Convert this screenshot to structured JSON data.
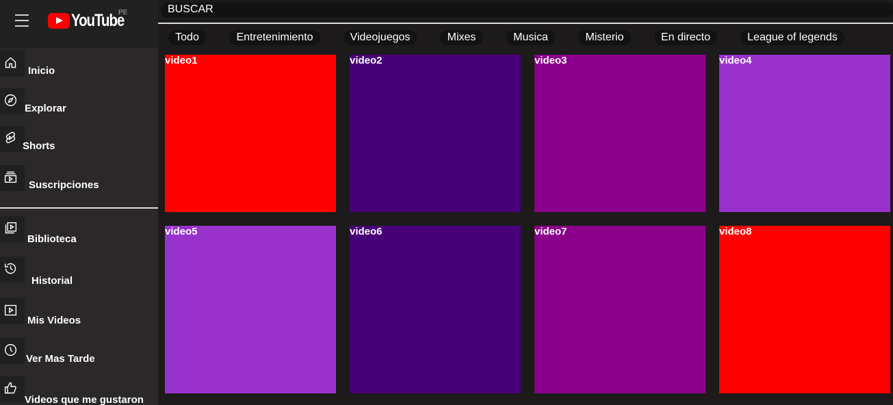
{
  "header": {
    "brand": "YouTube",
    "country": "PE",
    "search_placeholder": "BUSCAR"
  },
  "sidebar": {
    "main_items": [
      {
        "label": "Inicio",
        "icon": "home-icon"
      },
      {
        "label": "Explorar",
        "icon": "compass-icon"
      },
      {
        "label": "Shorts",
        "icon": "shorts-icon"
      },
      {
        "label": "Suscripciones",
        "icon": "subscriptions-icon"
      }
    ],
    "library_items": [
      {
        "label": "Biblioteca",
        "icon": "library-icon"
      },
      {
        "label": "Historial",
        "icon": "history-icon"
      },
      {
        "label": "Mis Videos",
        "icon": "my-videos-icon"
      },
      {
        "label": "Ver Mas Tarde",
        "icon": "clock-icon"
      },
      {
        "label": "Videos que me gustaron",
        "icon": "thumbs-up-icon"
      }
    ]
  },
  "chips": [
    "Todo",
    "Entretenimiento",
    "Videojuegos",
    "Mixes",
    "Musica",
    "Misterio",
    "En directo",
    "League of legends"
  ],
  "videos": [
    {
      "title": "video1",
      "color": "#ff0000"
    },
    {
      "title": "video2",
      "color": "#480078"
    },
    {
      "title": "video3",
      "color": "#8b008b"
    },
    {
      "title": "video4",
      "color": "#9932cc"
    },
    {
      "title": "video5",
      "color": "#9932cc"
    },
    {
      "title": "video6",
      "color": "#480078"
    },
    {
      "title": "video7",
      "color": "#8b008b"
    },
    {
      "title": "video8",
      "color": "#ff0000"
    }
  ],
  "colors": {
    "background": "#1c1a1a",
    "sidebar": "#2a2828",
    "logo_red": "#ff0000"
  }
}
